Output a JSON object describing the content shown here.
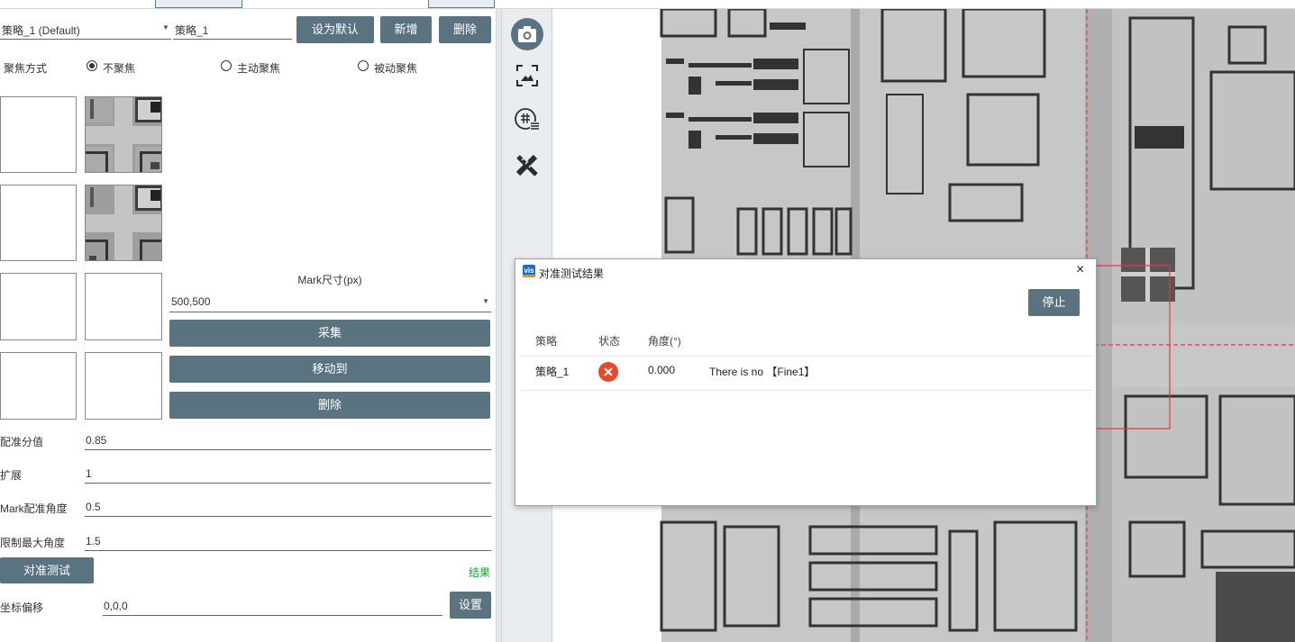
{
  "strategy": {
    "selected": "策略_1 (Default)",
    "name_value": "策略_1",
    "set_default_label": "设为默认",
    "add_label": "新增",
    "delete_label": "删除"
  },
  "focus": {
    "label": "聚焦方式",
    "options": [
      "不聚焦",
      "主动聚焦",
      "被动聚焦"
    ],
    "selected_index": 0
  },
  "mark": {
    "size_label": "Mark尺寸(px)",
    "size_value": "500,500",
    "capture_label": "采集",
    "move_to_label": "移动到",
    "delete_label": "删除"
  },
  "params": {
    "score_label": "配准分值",
    "score_value": "0.85",
    "expand_label": "扩展",
    "expand_value": "1",
    "mark_angle_label": "Mark配准角度",
    "mark_angle_value": "0.5",
    "max_angle_label": "限制最大角度",
    "max_angle_value": "1.5"
  },
  "actions": {
    "align_test_label": "对准测试",
    "result_link": "结果",
    "offset_label": "坐标偏移",
    "offset_value": "0,0,0",
    "set_label": "设置"
  },
  "toolbar": {
    "icons": [
      "camera-icon",
      "image-capture-icon",
      "grid-settings-icon",
      "ruler-tool-icon"
    ]
  },
  "dialog": {
    "logo_text": "vis",
    "title": "对准测试结果",
    "close_symbol": "×",
    "stop_label": "停止",
    "columns": [
      "策略",
      "状态",
      "角度(°)"
    ],
    "rows": [
      {
        "strategy": "策略_1",
        "status": "error",
        "angle": "0.000",
        "message": "There is no 【Fine1】"
      }
    ]
  },
  "colors": {
    "button": "#5a7381",
    "result_link": "#1a9c2a",
    "error": "#e8482c",
    "overlay_line": "#e53935"
  }
}
